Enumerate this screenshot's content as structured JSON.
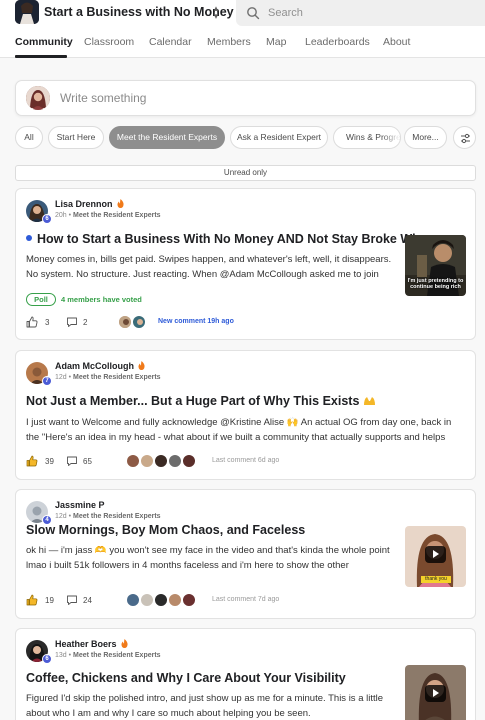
{
  "header": {
    "community_title": "Start a Business with No Money",
    "switch_icon": "chevron-up-down-icon",
    "search_placeholder": "Search"
  },
  "tabs": [
    {
      "label": "Community",
      "active": true
    },
    {
      "label": "Classroom"
    },
    {
      "label": "Calendar"
    },
    {
      "label": "Members"
    },
    {
      "label": "Map"
    },
    {
      "label": "Leaderboards"
    },
    {
      "label": "About"
    }
  ],
  "composer": {
    "placeholder": "Write something"
  },
  "filters": [
    {
      "label": "All"
    },
    {
      "label": "Start Here"
    },
    {
      "label": "Meet the Resident Experts",
      "active": true
    },
    {
      "label": "Ask a Resident Expert"
    },
    {
      "label": "Wins & Progre"
    },
    {
      "label": "More..."
    }
  ],
  "unread_filter": "Unread only",
  "colors": {
    "accent_blue": "#2e5bd8",
    "poll_green": "#37a04a",
    "active_chip": "#8e8e8e",
    "level_badge": "#4b5bd5"
  },
  "posts": [
    {
      "author": "Lisa Drennon",
      "level": "6",
      "time": "20h",
      "separator": " • ",
      "category": "Meet the Resident Experts",
      "title": "How to Start a Business With No Money AND Not Stay Broke Wh...",
      "body_line1": "Money comes in, bills get paid. Swipes happen, and whatever's left, well, it disappears.",
      "body_line2": "No system. No structure. Just reacting. When @Adam McCollough asked me to join",
      "poll_label": "Poll",
      "poll_text": "4 members have voted",
      "likes": "3",
      "comments": "2",
      "activity": "New comment 19h ago",
      "thumbnail_caption": "I'm just pretending to continue being rich"
    },
    {
      "author": "Adam McCollough",
      "level": "7",
      "time": "12d",
      "separator": " • ",
      "category": "Meet the Resident Experts",
      "title": "Not Just a Member... But a Huge Part of Why This Exists",
      "body_line1": "I just want to Welcome and fully acknowledge @Kristine Alise 🙌 An actual OG from day one, back in",
      "body_line2": "the \"Here's an idea in my head - what about if we built a community that actually supports and helps",
      "likes": "39",
      "comments": "65",
      "activity": "Last comment 6d ago"
    },
    {
      "author": "Jassmine P",
      "level": "4",
      "time": "12d",
      "separator": " • ",
      "category": "Meet the Resident Experts",
      "title": "Slow Mornings, Boy Mom Chaos, and Faceless",
      "body_line1": "ok hi — i'm jass 🫶 you won't see my face in the video and that's kinda the whole point",
      "body_line2": "lmao i built 51k followers in 4 months faceless and i'm here to show the other",
      "likes": "19",
      "comments": "24",
      "activity": "Last comment 7d ago",
      "thumbnail_caption": "thank you"
    },
    {
      "author": "Heather Boers",
      "level": "6",
      "time": "13d",
      "separator": " • ",
      "category": "Meet the Resident Experts",
      "title": "Coffee, Chickens and Why I Care About Your Visibility",
      "body_line1": "Figured I'd skip the polished intro, and just show up as me for a minute. This is a little",
      "body_line2": "about who I am and why I care so much about helping you be seen."
    }
  ]
}
